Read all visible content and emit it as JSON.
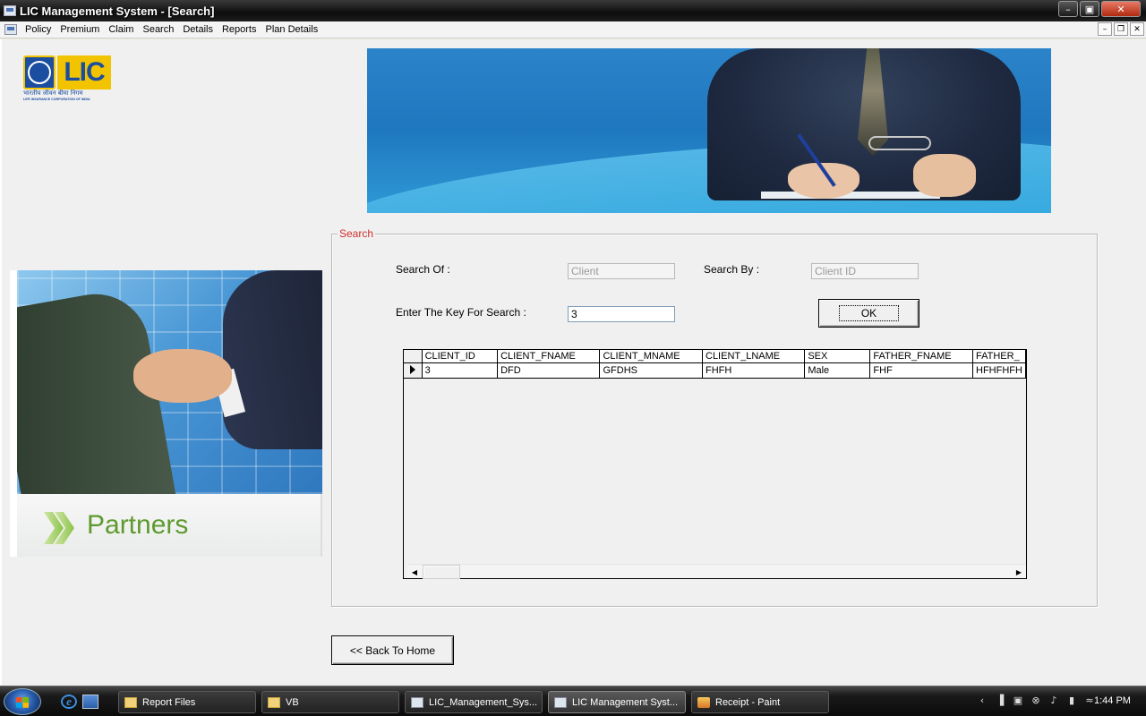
{
  "window": {
    "title": "LIC Management System - [Search]",
    "buttons": {
      "minimize": "–",
      "restore": "▣",
      "close": "✕"
    }
  },
  "menu": {
    "items": [
      "Policy",
      "Premium",
      "Claim",
      "Search",
      "Details",
      "Reports",
      "Plan Details"
    ],
    "mdi_buttons": {
      "minimize": "–",
      "restore": "❐",
      "close": "✕"
    }
  },
  "logo": {
    "text": "LIC",
    "hindi": "भारतीय जीवन बीमा निगम",
    "english": "LIFE INSURANCE CORPORATION OF INDIA"
  },
  "partners": {
    "label": "Partners"
  },
  "search": {
    "legend": "Search",
    "search_of_label": "Search Of :",
    "search_of_value": "Client",
    "search_by_label": "Search By :",
    "search_by_value": "Client ID",
    "key_label": "Enter The Key For Search :",
    "key_value": "3",
    "ok_label": "OK"
  },
  "grid": {
    "columns": [
      "CLIENT_ID",
      "CLIENT_FNAME",
      "CLIENT_MNAME",
      "CLIENT_LNAME",
      "SEX",
      "FATHER_FNAME",
      "FATHER_"
    ],
    "rows": [
      [
        "3",
        "DFD",
        "GFDHS",
        "FHFH",
        "Male",
        "FHF",
        "HFHFHFH"
      ]
    ],
    "scroll_left": "◀",
    "scroll_right": "▶"
  },
  "back_button": {
    "label": "<< Back To Home"
  },
  "taskbar": {
    "tasks": [
      {
        "label": "Report Files",
        "icon": "folder-icon"
      },
      {
        "label": "VB",
        "icon": "folder-icon"
      },
      {
        "label": "LIC_Management_Sys...",
        "icon": "app-icon"
      },
      {
        "label": "LIC Management Syst...",
        "icon": "app-icon"
      },
      {
        "label": "Receipt - Paint",
        "icon": "paint-icon"
      }
    ],
    "tray_icons": [
      "‹",
      "▐",
      "▣",
      "⊗",
      "♪",
      "▮",
      "≈"
    ],
    "clock": "1:44 PM"
  }
}
